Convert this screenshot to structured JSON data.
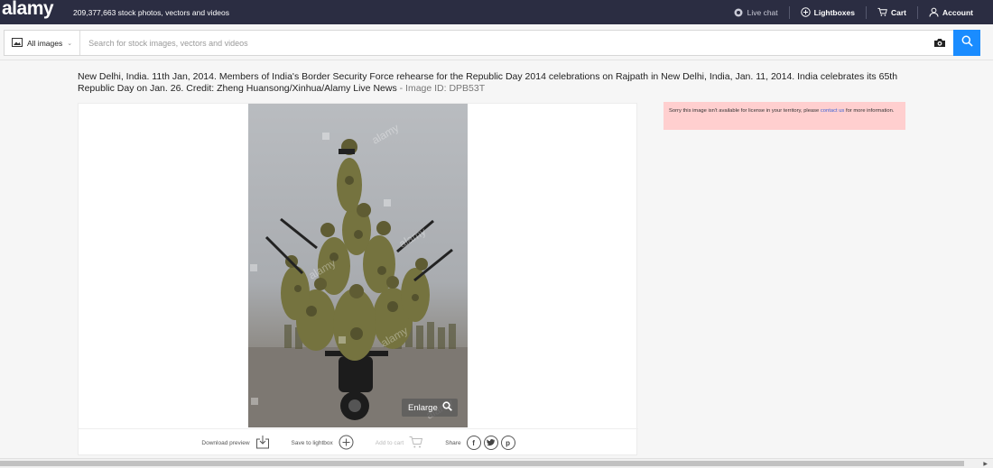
{
  "header": {
    "logo": "alamy",
    "tagline": "209,377,663 stock photos, vectors and videos",
    "nav": [
      {
        "label": "Live chat",
        "icon": "chat-icon"
      },
      {
        "label": "Lightboxes",
        "icon": "plus-circle-icon"
      },
      {
        "label": "Cart",
        "icon": "cart-icon"
      },
      {
        "label": "Account",
        "icon": "user-icon"
      }
    ]
  },
  "search": {
    "category": "All images",
    "placeholder": "Search for stock images, vectors and videos",
    "value": ""
  },
  "caption": {
    "text": "New Delhi, India. 11th Jan, 2014. Members of India's Border Security Force rehearse for the Republic Day 2014 celebrations on Rajpath in New Delhi, India, Jan. 11, 2014. India celebrates its 65th Republic Day on Jan. 26. Credit: Zheng Huansong/Xinhua/Alamy Live News",
    "image_id_label": " - Image ID: DPB53T"
  },
  "image": {
    "watermark": "alamy",
    "enlarge_label": "Enlarge"
  },
  "actions": {
    "download_label": "Download preview",
    "lightbox_label": "Save to lightbox",
    "cart_label": "Add to cart",
    "share_label": "Share"
  },
  "notice": {
    "text_before": "Sorry this image isn't available for license in your territory, please ",
    "link": "contact us",
    "text_after": " for more information."
  },
  "colors": {
    "header_bg": "#2b2d42",
    "search_button": "#1a8cff",
    "notice_bg": "#ffcfcf",
    "link": "#3d63d6"
  }
}
